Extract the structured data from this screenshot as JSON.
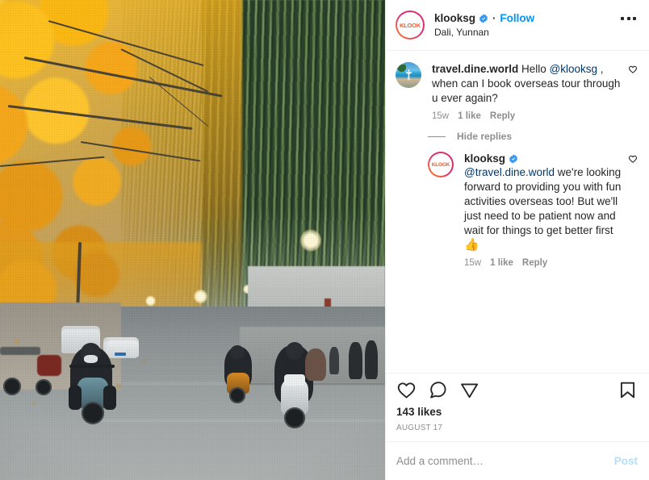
{
  "post": {
    "header": {
      "username": "klooksg",
      "verified": true,
      "separator": "·",
      "follow_label": "Follow",
      "location": "Dali, Yunnan",
      "more_options": "more-options"
    },
    "media": {
      "alt": "Street lined with golden ginkgo trees and green weeping willows, scooter riders on the road"
    },
    "comments": [
      {
        "author": "travel.dine.world",
        "avatar": "beach-photo",
        "verified": false,
        "text_parts": [
          {
            "type": "author",
            "value": "travel.dine.world"
          },
          {
            "type": "text",
            "value": " Hello "
          },
          {
            "type": "mention",
            "value": "@klooksg"
          },
          {
            "type": "text",
            "value": " , when can I book overseas tour through u ever again?"
          }
        ],
        "time": "15w",
        "likes": "1 like",
        "reply_label": "Reply"
      }
    ],
    "replies_toggle": {
      "label": "Hide replies",
      "expanded": true
    },
    "replies": [
      {
        "author": "klooksg",
        "avatar": "klook-logo",
        "verified": true,
        "text_parts": [
          {
            "type": "mention",
            "value": "@travel.dine.world"
          },
          {
            "type": "text",
            "value": " we're looking forward to providing you with fun activities overseas too! But we'll just need to be patient now and wait for things to get better first "
          },
          {
            "type": "emoji",
            "value": "👍"
          }
        ],
        "time": "15w",
        "likes": "1 like",
        "reply_label": "Reply"
      }
    ],
    "actions": {
      "like": "heart-icon",
      "comment": "comment-icon",
      "share": "share-icon",
      "save": "bookmark-icon"
    },
    "likes_count": "143 likes",
    "date": "AUGUST 17",
    "add_comment": {
      "placeholder": "Add a comment…",
      "value": "",
      "post_label": "Post"
    }
  },
  "colors": {
    "link": "#0095f6",
    "mention": "#00376b",
    "text": "#262626",
    "muted": "#8e8e8e",
    "border": "#efefef",
    "post_disabled": "#b2dffc",
    "verified_blue": "#3897f0"
  }
}
